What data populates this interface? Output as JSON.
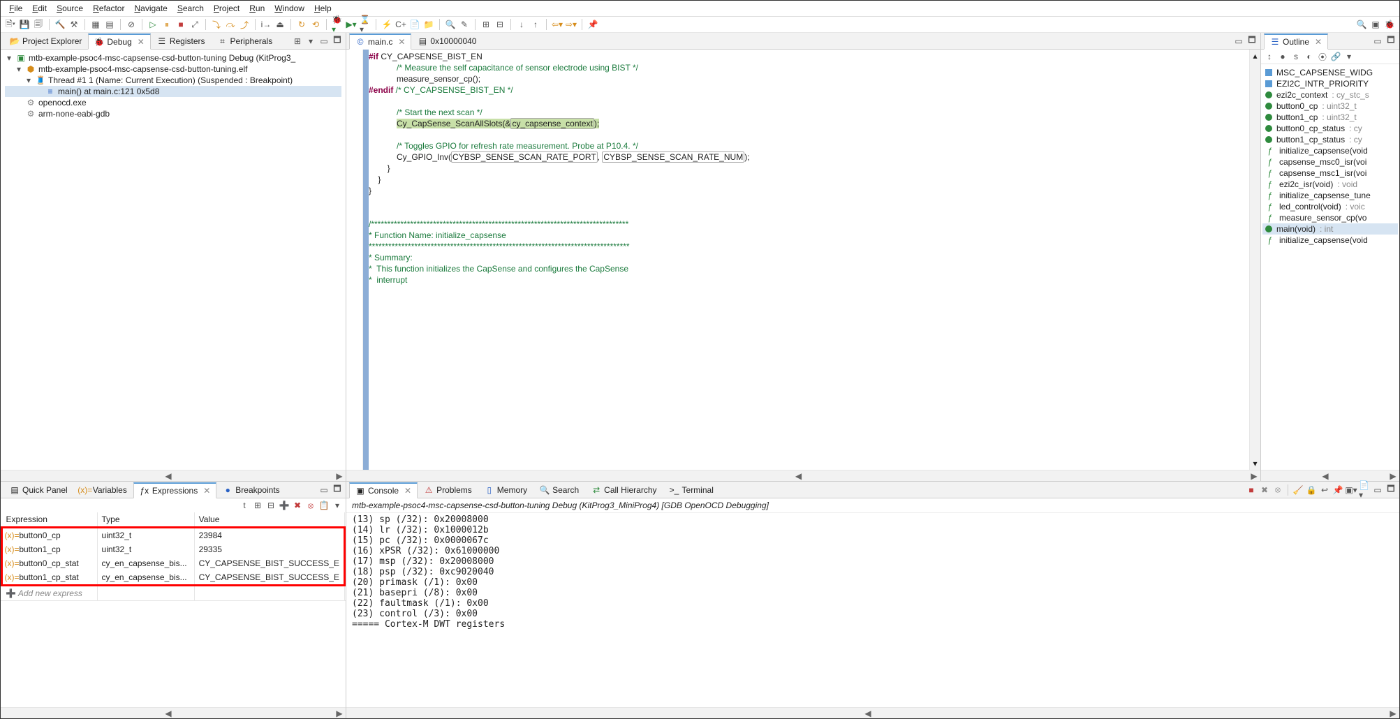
{
  "menu": [
    "File",
    "Edit",
    "Source",
    "Refactor",
    "Navigate",
    "Search",
    "Project",
    "Run",
    "Window",
    "Help"
  ],
  "top_tabs": {
    "project_explorer": "Project Explorer",
    "debug": "Debug",
    "registers": "Registers",
    "peripherals": "Peripherals"
  },
  "debug_tree": {
    "root": "mtb-example-psoc4-msc-capsense-csd-button-tuning Debug (KitProg3_",
    "elf": "mtb-example-psoc4-msc-capsense-csd-button-tuning.elf",
    "thread": "Thread #1 1 (Name: Current Execution) (Suspended : Breakpoint)",
    "frame": "main() at main.c:121 0x5d8",
    "openocd": "openocd.exe",
    "gdb": "arm-none-eabi-gdb"
  },
  "editor_tabs": {
    "main": "main.c",
    "addr": "0x10000040"
  },
  "code": {
    "l1a": "#if",
    "l1b": " CY_CAPSENSE_BIST_EN",
    "l2": "            /* Measure the self capacitance of sensor electrode using BIST */",
    "l3": "            measure_sensor_cp();",
    "l4a": "#endif",
    "l4b": " /* CY_CAPSENSE_BIST_EN */",
    "l6": "            /* Start the next scan */",
    "l7a": "            ",
    "l7b": "Cy_CapSense_ScanAllSlots(&",
    "l7c": "cy_capsense_context",
    "l7d": ");",
    "l9": "            /* Toggles GPIO for refresh rate measurement. Probe at P10.4. */",
    "l10a": "            Cy_GPIO_Inv(",
    "l10b": "CYBSP_SENSE_SCAN_RATE_PORT",
    "l10c": ", ",
    "l10d": "CYBSP_SENSE_SCAN_RATE_NUM",
    "l10e": ");",
    "l11": "        }",
    "l12": "    }",
    "l13": "}",
    "l15": "/*******************************************************************************",
    "l16": "* Function Name: initialize_capsense",
    "l17": "********************************************************************************",
    "l18": "* Summary:",
    "l19": "*  This function initializes the CapSense and configures the CapSense",
    "l20": "*  interrupt"
  },
  "bottom_tabs": {
    "quick": "Quick Panel",
    "variables": "Variables",
    "expressions": "Expressions",
    "breakpoints": "Breakpoints"
  },
  "expr_cols": {
    "c1": "Expression",
    "c2": "Type",
    "c3": "Value"
  },
  "expressions": [
    {
      "name": "button0_cp",
      "type": "uint32_t",
      "value": "23984"
    },
    {
      "name": "button1_cp",
      "type": "uint32_t",
      "value": "29335"
    },
    {
      "name": "button0_cp_stat",
      "type": "cy_en_capsense_bis...",
      "value": "CY_CAPSENSE_BIST_SUCCESS_E"
    },
    {
      "name": "button1_cp_stat",
      "type": "cy_en_capsense_bis...",
      "value": "CY_CAPSENSE_BIST_SUCCESS_E"
    }
  ],
  "add_expr": "Add new express",
  "console_tabs": {
    "console": "Console",
    "problems": "Problems",
    "memory": "Memory",
    "search": "Search",
    "call": "Call Hierarchy",
    "terminal": "Terminal"
  },
  "console_title": "mtb-example-psoc4-msc-capsense-csd-button-tuning Debug (KitProg3_MiniProg4) [GDB OpenOCD Debugging]",
  "console_lines": [
    "(13) sp (/32): 0x20008000",
    "(14) lr (/32): 0x1000012b",
    "(15) pc (/32): 0x0000067c",
    "(16) xPSR (/32): 0x61000000",
    "(17) msp (/32): 0x20008000",
    "(18) psp (/32): 0xc9020040",
    "(20) primask (/1): 0x00",
    "(21) basepri (/8): 0x00",
    "(22) faultmask (/1): 0x00",
    "(23) control (/3): 0x00",
    "===== Cortex-M DWT registers"
  ],
  "outline_title": "Outline",
  "outline": [
    {
      "icon": "#",
      "label": "MSC_CAPSENSE_WIDG",
      "type": ""
    },
    {
      "icon": "#",
      "label": "EZI2C_INTR_PRIORITY",
      "type": ""
    },
    {
      "icon": "●",
      "label": "ezi2c_context",
      "type": "cy_stc_s"
    },
    {
      "icon": "●",
      "label": "button0_cp",
      "type": "uint32_t"
    },
    {
      "icon": "●",
      "label": "button1_cp",
      "type": "uint32_t"
    },
    {
      "icon": "●",
      "label": "button0_cp_status",
      "type": "cy"
    },
    {
      "icon": "●",
      "label": "button1_cp_status",
      "type": "cy"
    },
    {
      "icon": "f",
      "label": "initialize_capsense(void",
      "type": ""
    },
    {
      "icon": "f",
      "label": "capsense_msc0_isr(voi",
      "type": ""
    },
    {
      "icon": "f",
      "label": "capsense_msc1_isr(voi",
      "type": ""
    },
    {
      "icon": "f",
      "label": "ezi2c_isr(void)",
      "type": "void"
    },
    {
      "icon": "f",
      "label": "initialize_capsense_tune",
      "type": ""
    },
    {
      "icon": "f",
      "label": "led_control(void)",
      "type": "voic"
    },
    {
      "icon": "f",
      "label": "measure_sensor_cp(vo",
      "type": ""
    },
    {
      "icon": "●",
      "label": "main(void)",
      "type": "int",
      "sel": true
    },
    {
      "icon": "f",
      "label": "initialize_capsense(void",
      "type": ""
    }
  ]
}
